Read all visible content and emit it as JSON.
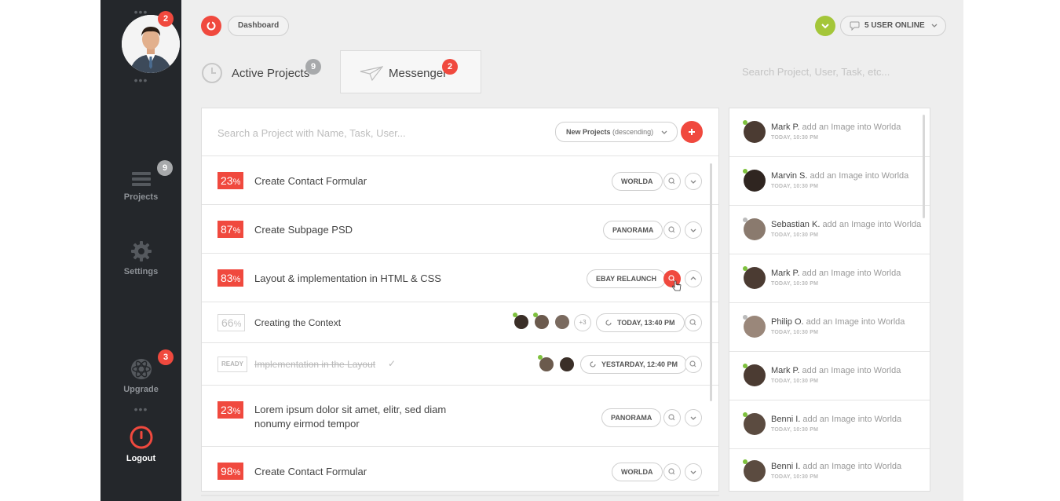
{
  "sidebar": {
    "user_badge": "2",
    "nav": [
      {
        "label": "Projects",
        "icon": "stack-icon",
        "badge": "9"
      },
      {
        "label": "Settings",
        "icon": "gear-icon"
      },
      {
        "label": "Upgrade",
        "icon": "atom-icon",
        "badge": "3"
      },
      {
        "label": "Logout",
        "icon": "power-icon"
      }
    ]
  },
  "header": {
    "breadcrumb": "Dashboard",
    "users_online": "5 USER ONLINE",
    "accent": "#f0493e",
    "online_color": "#a4c639"
  },
  "tabs": [
    {
      "label": "Active Projects",
      "badge": "9"
    },
    {
      "label": "Messenger",
      "badge": "2"
    }
  ],
  "global_search": {
    "placeholder": "Search Project, User, Task, etc..."
  },
  "projects_panel": {
    "search_placeholder": "Search a Project with Name, Task, User...",
    "sort_label": "New Projects",
    "sort_order": "(descending)",
    "rows": [
      {
        "percent": "23",
        "pct_sign": "%",
        "title": "Create Contact Formular",
        "tag": "WORLDA"
      },
      {
        "percent": "87",
        "pct_sign": "%",
        "title": "Create Subpage PSD",
        "tag": "PANORAMA"
      },
      {
        "percent": "83",
        "pct_sign": "%",
        "title": "Layout & implementation in HTML & CSS",
        "tag": "EBAY RELAUNCH"
      },
      {
        "percent": "66",
        "pct_sign": "%",
        "title": "Creating the Context",
        "extra_users": "+3",
        "time": "TODAY, 13:40 PM"
      },
      {
        "status": "READY",
        "title": "Implementation in the Layout",
        "check": "✓",
        "time": "YESTARDAY, 12:40 PM"
      },
      {
        "percent": "23",
        "pct_sign": "%",
        "title_line1": "Lorem ipsum dolor sit amet, elitr, sed diam",
        "title_line2": "nonumy eirmod tempor",
        "tag": "PANORAMA"
      },
      {
        "percent": "98",
        "pct_sign": "%",
        "title": "Create Contact Formular",
        "tag": "WORLDA"
      }
    ]
  },
  "feed": {
    "items": [
      {
        "name": "Mark P.",
        "action": "add an Image into Worlda",
        "time": "TODAY, 10:30 PM"
      },
      {
        "name": "Marvin S.",
        "action": "add an Image into Worlda",
        "time": "TODAY, 10:30 PM"
      },
      {
        "name": "Sebastian K.",
        "action": "add an Image into Worlda",
        "time": "TODAY, 10:30 PM"
      },
      {
        "name": "Mark P.",
        "action": "add an Image into Worlda",
        "time": "TODAY, 10:30 PM"
      },
      {
        "name": "Philip O.",
        "action": "add an Image into Worlda",
        "time": "TODAY, 10:30 PM"
      },
      {
        "name": "Mark P.",
        "action": "add an Image into Worlda",
        "time": "TODAY, 10:30 PM"
      },
      {
        "name": "Benni I.",
        "action": "add an Image into Worlda",
        "time": "TODAY, 10:30 PM"
      },
      {
        "name": "Benni I.",
        "action": "add an Image into Worlda",
        "time": "TODAY, 10:30 PM"
      }
    ]
  }
}
